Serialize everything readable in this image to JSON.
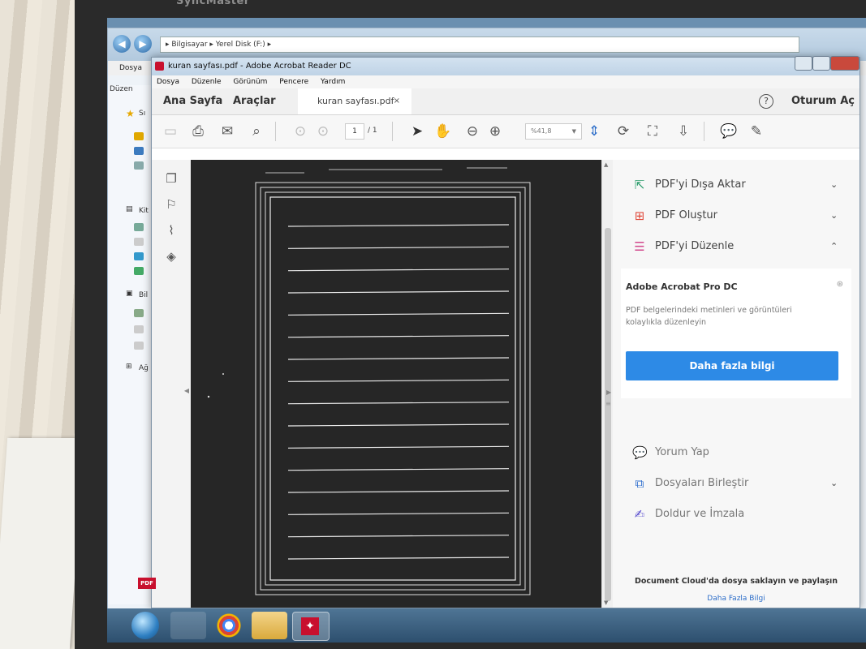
{
  "monitor": {
    "brand_label": "SyncMaster"
  },
  "explorer": {
    "path": "▸ Bilgisayar ▸ Yerel Disk (F:) ▸",
    "menu": [
      "Dosya",
      "Düzen"
    ],
    "sidebar_labels": [
      "Sı",
      "Kit",
      "Bil",
      "Ağ"
    ]
  },
  "acrobat": {
    "window_title": "kuran sayfası.pdf - Adobe Acrobat Reader DC",
    "menu": [
      "Dosya",
      "Düzenle",
      "Görünüm",
      "Pencere",
      "Yardım"
    ],
    "tabs": {
      "home": "Ana Sayfa",
      "tools": "Araçlar",
      "document": "kuran sayfası.pdf",
      "close": "×"
    },
    "help_icon": "?",
    "sign_in": "Oturum Aç",
    "toolbar": {
      "icons": [
        "save-icon",
        "print-icon",
        "email-icon",
        "search-icon",
        "prev-page-icon",
        "next-page-icon",
        "select-icon",
        "hand-icon",
        "zoom-out-icon",
        "zoom-in-icon",
        "fit-page-icon",
        "rotate-icon",
        "fullscreen-icon",
        "scroll-mode-icon",
        "comment-icon",
        "pen-icon"
      ],
      "page_current": "1",
      "page_total": "/ 1",
      "zoom": "%41,8"
    },
    "page": {
      "ruled_lines": 16
    }
  },
  "right_panel": {
    "top_items": [
      {
        "label": "PDF'yi Dışa Aktar",
        "icon": "export-pdf-icon",
        "color": "#2e9e6e",
        "chevron": "⌄"
      },
      {
        "label": "PDF Oluştur",
        "icon": "create-pdf-icon",
        "color": "#e04a3b",
        "chevron": "⌄"
      },
      {
        "label": "PDF'yi Düzenle",
        "icon": "edit-pdf-icon",
        "color": "#d2478c",
        "chevron": "⌃"
      }
    ],
    "promo": {
      "title": "Adobe Acrobat Pro DC",
      "description": "PDF belgelerindeki metinleri ve görüntüleri kolaylıkla düzenleyin",
      "button": "Daha fazla bilgi"
    },
    "bottom_items": [
      {
        "label": "Yorum Yap",
        "icon": "comment-icon",
        "color": "#f0b400",
        "chevron": ""
      },
      {
        "label": "Dosyaları Birleştir",
        "icon": "combine-files-icon",
        "color": "#2f6fce",
        "chevron": "⌄"
      },
      {
        "label": "Doldur ve İmzala",
        "icon": "fill-sign-icon",
        "color": "#5a4fcf",
        "chevron": ""
      }
    ],
    "cloud_text": "Document Cloud'da dosya saklayın ve paylaşın",
    "cloud_link": "Daha Fazla Bilgi"
  },
  "taskbar": {
    "apps": [
      "start-button",
      "explorer-icon",
      "chrome-icon",
      "folder-icon",
      "acrobat-icon"
    ],
    "pdf_badge": "PDF"
  }
}
